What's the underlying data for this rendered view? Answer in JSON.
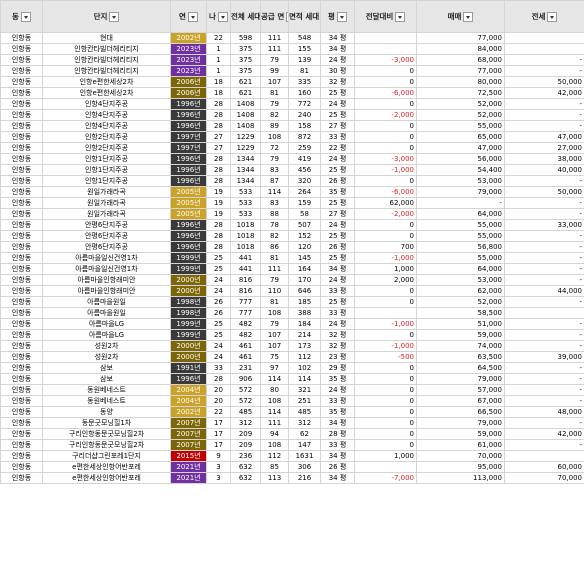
{
  "headers": [
    {
      "label": "동",
      "name": "dong",
      "filter": "filter-active"
    },
    {
      "label": "단지",
      "name": "complex",
      "filter": "sort-desc"
    },
    {
      "label": "연",
      "name": "year",
      "filter": "dropdown"
    },
    {
      "label": "나",
      "name": "age",
      "filter": "dropdown"
    },
    {
      "label": "전체 세대",
      "name": "total-households",
      "filter": "dropdown"
    },
    {
      "label": "공급 면",
      "name": "supply-area",
      "filter": "dropdown"
    },
    {
      "label": "면적 세대",
      "name": "area-households",
      "filter": "dropdown"
    },
    {
      "label": "평",
      "name": "pyeong",
      "filter": "dropdown"
    },
    {
      "label": "전달대비",
      "name": "vs-last-month",
      "filter": "dropdown"
    },
    {
      "label": "매매",
      "name": "sale-price",
      "filter": "dropdown"
    },
    {
      "label": "전세",
      "name": "jeonse-price",
      "filter": "dropdown"
    }
  ],
  "rows": [
    [
      "인항동",
      "현대",
      "2002년",
      "22",
      "598",
      "111",
      "548",
      "34 평",
      "",
      "77,000",
      ""
    ],
    [
      "인항동",
      "인항칸타빌더헤리티지",
      "2023년",
      "1",
      "375",
      "111",
      "155",
      "34 평",
      "",
      "84,000",
      ""
    ],
    [
      "인항동",
      "인항칸타빌더헤리티지",
      "2023년",
      "1",
      "375",
      "79",
      "139",
      "24 평",
      "-3,000",
      "68,000",
      "-"
    ],
    [
      "인항동",
      "인항칸타빌더헤리티지",
      "2023년",
      "1",
      "375",
      "99",
      "81",
      "30 평",
      "0",
      "77,000",
      "-"
    ],
    [
      "인항동",
      "인항e편한세상2차",
      "2006년",
      "18",
      "621",
      "107",
      "335",
      "32 평",
      "0",
      "80,000",
      "50,000"
    ],
    [
      "인항동",
      "인항e편한세상2차",
      "2006년",
      "18",
      "621",
      "81",
      "160",
      "25 평",
      "-6,000",
      "72,500",
      "42,000"
    ],
    [
      "인항동",
      "인항4단지주공",
      "1996년",
      "28",
      "1408",
      "79",
      "772",
      "24 평",
      "0",
      "52,000",
      "-"
    ],
    [
      "인항동",
      "인항4단지주공",
      "1996년",
      "28",
      "1408",
      "82",
      "240",
      "25 평",
      "-2,000",
      "52,000",
      "-"
    ],
    [
      "인항동",
      "인항4단지주공",
      "1996년",
      "28",
      "1408",
      "89",
      "158",
      "27 평",
      "0",
      "55,000",
      "-"
    ],
    [
      "인항동",
      "인항2단지주공",
      "1997년",
      "27",
      "1229",
      "108",
      "872",
      "33 평",
      "0",
      "65,000",
      "47,000"
    ],
    [
      "인항동",
      "인항2단지주공",
      "1997년",
      "27",
      "1229",
      "72",
      "259",
      "22 평",
      "0",
      "47,000",
      "27,000"
    ],
    [
      "인항동",
      "인항1단지주공",
      "1996년",
      "28",
      "1344",
      "79",
      "419",
      "24 평",
      "-3,000",
      "56,000",
      "38,000"
    ],
    [
      "인항동",
      "인항1단지주공",
      "1996년",
      "28",
      "1344",
      "83",
      "456",
      "25 평",
      "-1,000",
      "54,400",
      "40,000"
    ],
    [
      "인항동",
      "인항1단지주공",
      "1996년",
      "28",
      "1344",
      "87",
      "320",
      "26 평",
      "0",
      "53,000",
      "-"
    ],
    [
      "인항동",
      "원일가래라곡",
      "2005년",
      "19",
      "533",
      "114",
      "264",
      "35 평",
      "-6,000",
      "79,000",
      "50,000"
    ],
    [
      "인항동",
      "원일가래라곡",
      "2005년",
      "19",
      "533",
      "83",
      "159",
      "25 평",
      "62,000",
      "-",
      "-"
    ],
    [
      "인항동",
      "원일가래라곡",
      "2005년",
      "19",
      "533",
      "88",
      "58",
      "27 평",
      "-2,000",
      "64,000",
      "-"
    ],
    [
      "인항동",
      "안평6단지주공",
      "1996년",
      "28",
      "1018",
      "78",
      "507",
      "24 평",
      "0",
      "55,000",
      "33,000"
    ],
    [
      "인항동",
      "안평6단지주공",
      "1996년",
      "28",
      "1018",
      "82",
      "152",
      "25 평",
      "0",
      "55,000",
      "-"
    ],
    [
      "인항동",
      "안평6단지주공",
      "1996년",
      "28",
      "1018",
      "86",
      "120",
      "26 평",
      "700",
      "56,800",
      "-"
    ],
    [
      "인항동",
      "아름마을일신건영1차",
      "1999년",
      "25",
      "441",
      "81",
      "145",
      "25 평",
      "-1,000",
      "55,000",
      "-"
    ],
    [
      "인항동",
      "아름마을일신건영1차",
      "1999년",
      "25",
      "441",
      "111",
      "164",
      "34 평",
      "1,000",
      "64,000",
      "-"
    ],
    [
      "인항동",
      "아름마을인항래미안",
      "2000년",
      "24",
      "816",
      "79",
      "170",
      "24 평",
      "2,000",
      "53,000",
      "-"
    ],
    [
      "인항동",
      "아름마을인항래미안",
      "2000년",
      "24",
      "816",
      "110",
      "646",
      "33 평",
      "0",
      "62,000",
      "44,000"
    ],
    [
      "인항동",
      "아름마을원일",
      "1998년",
      "26",
      "777",
      "81",
      "185",
      "25 평",
      "0",
      "52,000",
      "-"
    ],
    [
      "인항동",
      "아름마을원일",
      "1998년",
      "26",
      "777",
      "108",
      "388",
      "33 평",
      "",
      "58,500",
      ""
    ],
    [
      "인항동",
      "아름마을LG",
      "1999년",
      "25",
      "482",
      "79",
      "184",
      "24 평",
      "-1,000",
      "51,000",
      "-"
    ],
    [
      "인항동",
      "아름마을LG",
      "1999년",
      "25",
      "482",
      "107",
      "214",
      "32 평",
      "0",
      "59,000",
      "-"
    ],
    [
      "인항동",
      "성원2차",
      "2000년",
      "24",
      "461",
      "107",
      "173",
      "32 평",
      "-1,000",
      "74,000",
      "-"
    ],
    [
      "인항동",
      "성원2차",
      "2000년",
      "24",
      "461",
      "75",
      "112",
      "23 평",
      "-500",
      "63,500",
      "39,000"
    ],
    [
      "인항동",
      "삼보",
      "1991년",
      "33",
      "231",
      "97",
      "102",
      "29 평",
      "0",
      "64,500",
      "-"
    ],
    [
      "인항동",
      "삼보",
      "1996년",
      "28",
      "906",
      "114",
      "114",
      "35 평",
      "0",
      "79,000",
      "-"
    ],
    [
      "인항동",
      "동원베네스트",
      "2004년",
      "20",
      "572",
      "80",
      "321",
      "24 평",
      "0",
      "57,000",
      "-"
    ],
    [
      "인항동",
      "동원베네스트",
      "2004년",
      "20",
      "572",
      "108",
      "251",
      "33 평",
      "0",
      "67,000",
      "-"
    ],
    [
      "인항동",
      "동양",
      "2002년",
      "22",
      "485",
      "114",
      "485",
      "35 평",
      "0",
      "66,500",
      "48,000"
    ],
    [
      "인항동",
      "동문굿모닝힐1차",
      "2007년",
      "17",
      "312",
      "111",
      "312",
      "34 평",
      "0",
      "79,000",
      "-"
    ],
    [
      "인항동",
      "구리인항동문굿모닝힐2차",
      "2007년",
      "17",
      "209",
      "94",
      "62",
      "28 평",
      "0",
      "59,000",
      "42,000"
    ],
    [
      "인항동",
      "구리인항동문굿모닝힐2차",
      "2007년",
      "17",
      "209",
      "108",
      "147",
      "33 평",
      "0",
      "61,000",
      "-"
    ],
    [
      "인항동",
      "구리더샵그린포레1단지",
      "2015년",
      "9",
      "236",
      "112",
      "1631",
      "34 평",
      "1,000",
      "70,000",
      ""
    ],
    [
      "인항동",
      "e편한세상인항어반포레",
      "2021년",
      "3",
      "632",
      "85",
      "306",
      "26 평",
      "",
      "95,000",
      "60,000"
    ],
    [
      "인항동",
      "e편한세상인항어반포레",
      "2021년",
      "3",
      "632",
      "113",
      "216",
      "34 평",
      "-7,000",
      "113,000",
      "70,000"
    ]
  ]
}
